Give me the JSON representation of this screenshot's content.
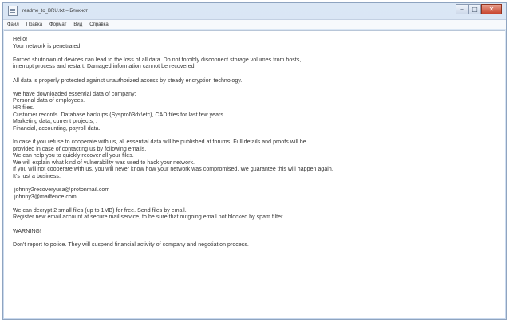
{
  "window": {
    "title": "readme_to_BRU.txt – Блокнот",
    "controls": {
      "minimize": "–",
      "maximize": "□",
      "close": "✕"
    }
  },
  "menu": {
    "items": [
      "Файл",
      "Правка",
      "Формат",
      "Вид",
      "Справка"
    ]
  },
  "document": {
    "paragraphs": [
      [
        "Hello!",
        "Your network is penetrated."
      ],
      [
        "Forced shutdown of devices can lead to the loss of all data. Do not forcibly disconnect storage volumes from hosts,",
        "interrupt process and restart. Damaged information cannot be recovered."
      ],
      [
        "All data is properly protected against unauthorized access by steady encryption technology."
      ],
      [
        "We have downloaded essential data of company:",
        "Personal data of employees.",
        "HR files.",
        "Customer records. Database backups (Sysprol\\3dx\\etc), CAD files for last few years.",
        "Marketing data, current projects, .",
        "Financial, accounting, payroll data."
      ],
      [
        "In case if you refuse to cooperate with us, all essential data will be published at forums. Full details and proofs will be",
        "provided in case of contacting us by following emails.",
        "We can help you to quickly recover all your files.",
        "We will explain what kind of vulnerability was used to hack your network.",
        "If you will not cooperate with us, you will never know how your network was compromised. We guarantee this will happen again.",
        "It's just a business."
      ],
      [
        " johnny2recoveryusa@protonmail.com",
        " johnny3@mailfence.com"
      ],
      [
        "We can decrypt 2 small files (up to 1MB) for free. Send files by email.",
        "Register new email account at secure mail service, to be sure that outgoing email not blocked by spam filter."
      ],
      [
        "WARNING!"
      ],
      [
        "Don't report to police. They will suspend financial activity of company and negotiation process."
      ]
    ]
  }
}
